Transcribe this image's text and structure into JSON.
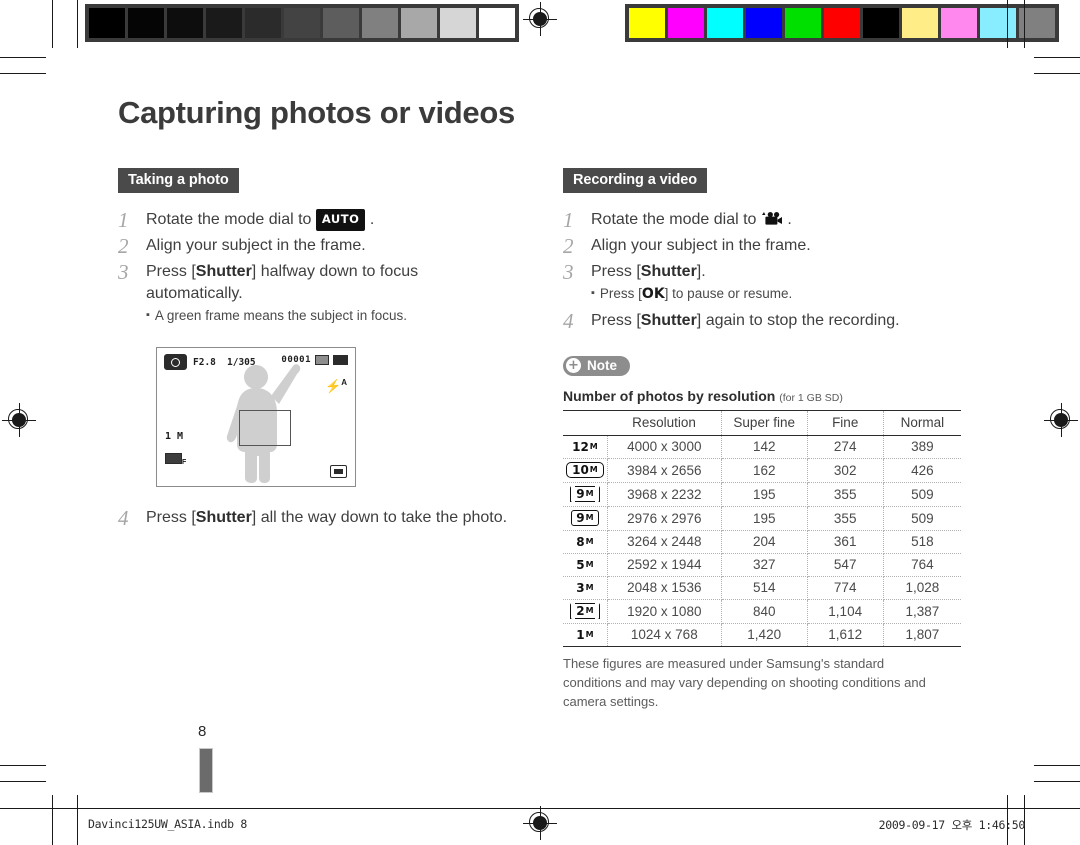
{
  "document": {
    "title": "Capturing photos or videos",
    "page_number": "8"
  },
  "calibration": {
    "gray_bar": [
      "#000000",
      "#050505",
      "#0d0d0d",
      "#1a1a1a",
      "#2b2b2b",
      "#434343",
      "#5d5d5d",
      "#808080",
      "#a8a8a8",
      "#d6d6d6",
      "#ffffff"
    ],
    "color_bar": [
      "#ffff00",
      "#ff00ff",
      "#00ffff",
      "#0000ff",
      "#00e000",
      "#ff0000",
      "#000000",
      "#ffee88",
      "#ff88ee",
      "#88eeff",
      "#808080"
    ]
  },
  "left_column": {
    "section_label": "Taking a photo",
    "steps": [
      {
        "num": "1",
        "prefix": "Rotate the mode dial to ",
        "chip": "AUTO",
        "suffix": " ."
      },
      {
        "num": "2",
        "text": "Align your subject in the frame."
      },
      {
        "num": "3",
        "prefix": "Press [",
        "strong": "Shutter",
        "suffix": "] halfway down to focus automatically.",
        "sub": "A green frame means the subject in focus."
      },
      {
        "num": "4",
        "prefix": "Press [",
        "strong": "Shutter",
        "suffix": "] all the way down to take the photo."
      }
    ],
    "lcd": {
      "aperture": "F2.8",
      "shutter_speed": "1/305",
      "shots_remaining": "00001",
      "iso": "1 M",
      "flash": "A",
      "icons": [
        "camera-mode-icon",
        "memory-card-icon",
        "battery-icon",
        "flash-auto-icon",
        "metering-icon",
        "anti-shake-icon",
        "focus-frame"
      ]
    }
  },
  "right_column": {
    "section_label": "Recording a video",
    "steps": [
      {
        "num": "1",
        "prefix": "Rotate the mode dial to ",
        "icon": "movie-camera-icon",
        "suffix": " ."
      },
      {
        "num": "2",
        "text": "Align your subject in the frame."
      },
      {
        "num": "3",
        "prefix": "Press [",
        "strong": "Shutter",
        "suffix": "].",
        "sub_prefix": "Press [",
        "sub_strong": "OK",
        "sub_suffix": "] to pause or resume."
      },
      {
        "num": "4",
        "prefix": "Press [",
        "strong": "Shutter",
        "suffix": "] again to stop the recording."
      }
    ],
    "note_badge": {
      "label": "Note",
      "icon": "plus-circle-icon"
    },
    "table": {
      "caption": "Number of photos by resolution",
      "caption_note": "(for 1 GB SD)",
      "headers": [
        "Resolution",
        "Super fine",
        "Fine",
        "Normal"
      ],
      "rows": [
        {
          "marker": "12",
          "marker_style": "plain",
          "resolution": "4000 x 3000",
          "super_fine": "142",
          "fine": "274",
          "normal": "389"
        },
        {
          "marker": "10",
          "marker_style": "rnd",
          "resolution": "3984 x 2656",
          "super_fine": "162",
          "fine": "302",
          "normal": "426"
        },
        {
          "marker": "9",
          "marker_style": "wide",
          "resolution": "3968 x 2232",
          "super_fine": "195",
          "fine": "355",
          "normal": "509"
        },
        {
          "marker": "9",
          "marker_style": "boxed",
          "resolution": "2976 x 2976",
          "super_fine": "195",
          "fine": "355",
          "normal": "509"
        },
        {
          "marker": "8",
          "marker_style": "plain",
          "resolution": "3264 x 2448",
          "super_fine": "204",
          "fine": "361",
          "normal": "518"
        },
        {
          "marker": "5",
          "marker_style": "plain",
          "resolution": "2592 x 1944",
          "super_fine": "327",
          "fine": "547",
          "normal": "764"
        },
        {
          "marker": "3",
          "marker_style": "plain",
          "resolution": "2048 x 1536",
          "super_fine": "514",
          "fine": "774",
          "normal": "1,028"
        },
        {
          "marker": "2",
          "marker_style": "wide",
          "resolution": "1920 x 1080",
          "super_fine": "840",
          "fine": "1,104",
          "normal": "1,387"
        },
        {
          "marker": "1",
          "marker_style": "plain",
          "resolution": "1024 x 768",
          "super_fine": "1,420",
          "fine": "1,612",
          "normal": "1,807"
        }
      ],
      "footnote": "These figures are measured under Samsung's standard conditions and may vary depending on shooting conditions and camera settings."
    }
  },
  "footer": {
    "filename": "Davinci125UW_ASIA.indb   8",
    "timestamp": "2009-09-17   오후 1:46:50"
  }
}
